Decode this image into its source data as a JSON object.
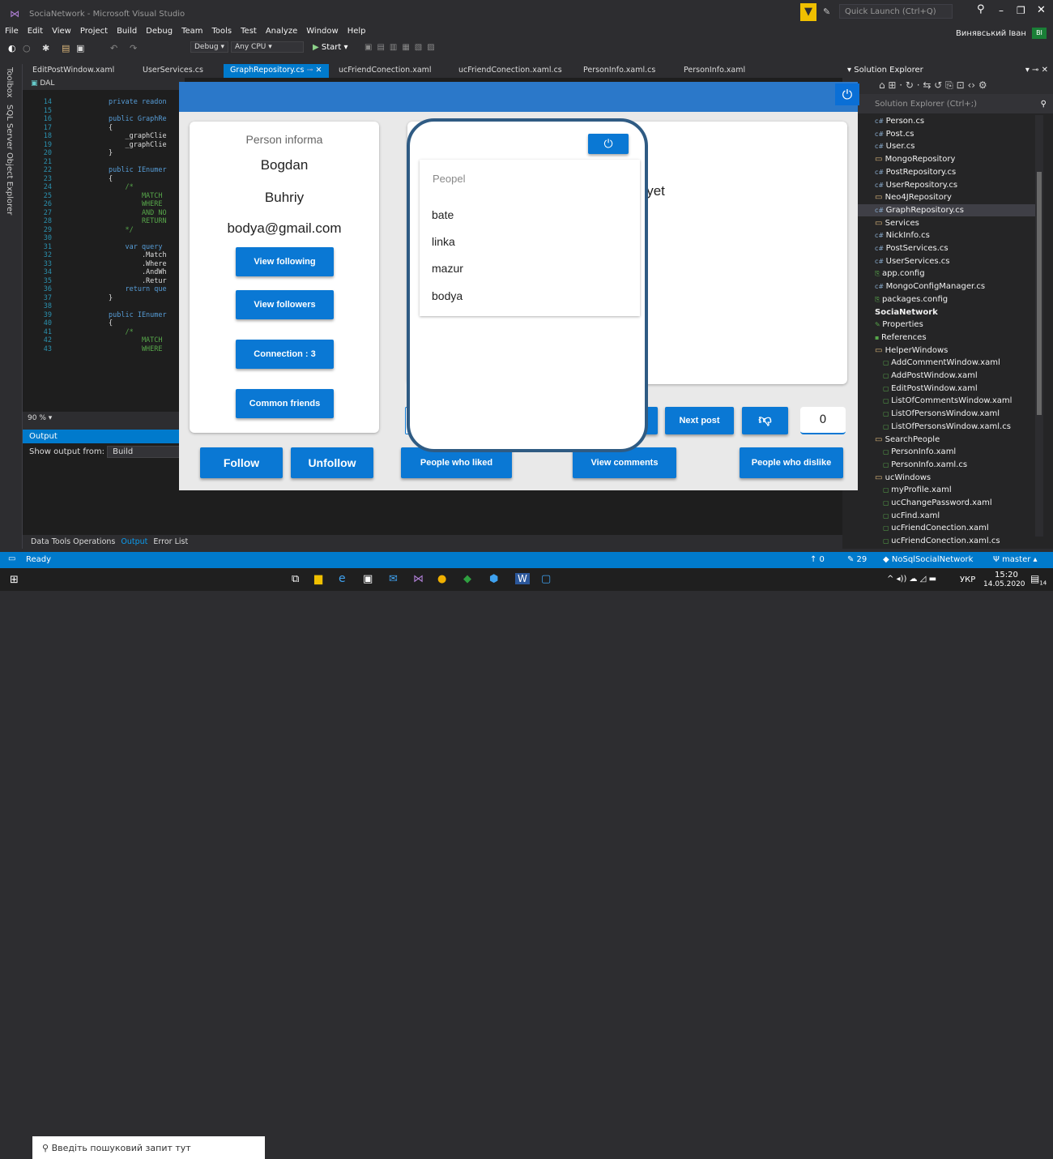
{
  "ide": {
    "window_title": "SociaNetwork - Microsoft Visual Studio",
    "quick_launch": "Quick Launch (Ctrl+Q)",
    "user": "Винявський Іван",
    "user_initials": "ВІ",
    "menu": [
      "File",
      "Edit",
      "View",
      "Project",
      "Build",
      "Debug",
      "Team",
      "Tools",
      "Test",
      "Analyze",
      "Window",
      "Help"
    ],
    "toolbar": {
      "config": "Debug",
      "platform": "Any CPU",
      "start": "Start"
    },
    "tabs": [
      "EditPostWindow.xaml",
      "UserServices.cs",
      "GraphRepository.cs",
      "ucFriendConection.xaml",
      "ucFriendConection.xaml.cs",
      "PersonInfo.xaml.cs",
      "PersonInfo.xaml"
    ],
    "left_rail": [
      "Toolbox",
      "SQL Server Object Explorer"
    ],
    "editor_project": "DAL",
    "zoom": "90 %",
    "output": {
      "title": "Output",
      "show_from_label": "Show output from:",
      "show_from_value": "Build"
    },
    "bottom_tabs": [
      "Data Tools Operations",
      "Output",
      "Error List"
    ],
    "code_lines": [
      {
        "n": "14",
        "t": "private readon"
      },
      {
        "n": "15",
        "t": ""
      },
      {
        "n": "16",
        "t": "public GraphRe"
      },
      {
        "n": "17",
        "t": "{"
      },
      {
        "n": "18",
        "t": "    _graphClie"
      },
      {
        "n": "19",
        "t": "    _graphClie"
      },
      {
        "n": "20",
        "t": "}"
      },
      {
        "n": "21",
        "t": ""
      },
      {
        "n": "22",
        "t": "public IEnumer"
      },
      {
        "n": "23",
        "t": "{"
      },
      {
        "n": "24",
        "t": "    /*"
      },
      {
        "n": "25",
        "t": "        MATCH"
      },
      {
        "n": "26",
        "t": "        WHERE"
      },
      {
        "n": "27",
        "t": "        AND NO"
      },
      {
        "n": "28",
        "t": "        RETURN"
      },
      {
        "n": "29",
        "t": "    */"
      },
      {
        "n": "30",
        "t": ""
      },
      {
        "n": "31",
        "t": "    var query"
      },
      {
        "n": "32",
        "t": "        .Match"
      },
      {
        "n": "33",
        "t": "        .Where"
      },
      {
        "n": "34",
        "t": "        .AndWh"
      },
      {
        "n": "35",
        "t": "        .Retur"
      },
      {
        "n": "36",
        "t": "    return que"
      },
      {
        "n": "37",
        "t": "}"
      },
      {
        "n": "38",
        "t": ""
      },
      {
        "n": "39",
        "t": "public IEnumer"
      },
      {
        "n": "40",
        "t": "{"
      },
      {
        "n": "41",
        "t": "    /*"
      },
      {
        "n": "42",
        "t": "        MATCH"
      },
      {
        "n": "43",
        "t": "        WHERE"
      }
    ],
    "solution_explorer": {
      "title": "Solution Explorer",
      "search": "Solution Explorer (Ctrl+;)",
      "items": [
        {
          "label": "Person.cs",
          "kind": "cs"
        },
        {
          "label": "Post.cs",
          "kind": "cs"
        },
        {
          "label": "User.cs",
          "kind": "cs"
        },
        {
          "label": "MongoRepository",
          "kind": "folder"
        },
        {
          "label": "PostRepository.cs",
          "kind": "cs"
        },
        {
          "label": "UserRepository.cs",
          "kind": "cs"
        },
        {
          "label": "Neo4JRepository",
          "kind": "folder"
        },
        {
          "label": "GraphRepository.cs",
          "kind": "cs",
          "selected": true
        },
        {
          "label": "Services",
          "kind": "folder"
        },
        {
          "label": "NickInfo.cs",
          "kind": "cs"
        },
        {
          "label": "PostServices.cs",
          "kind": "cs"
        },
        {
          "label": "UserServices.cs",
          "kind": "cs"
        },
        {
          "label": "app.config",
          "kind": "cfg"
        },
        {
          "label": "MongoConfigManager.cs",
          "kind": "cs"
        },
        {
          "label": "packages.config",
          "kind": "cfg"
        },
        {
          "label": "SociaNetwork",
          "kind": "project"
        },
        {
          "label": "Properties",
          "kind": "prop"
        },
        {
          "label": "References",
          "kind": "ref"
        },
        {
          "label": "HelperWindows",
          "kind": "folder"
        },
        {
          "label": "AddCommentWindow.xaml",
          "kind": "xaml"
        },
        {
          "label": "AddPostWindow.xaml",
          "kind": "xaml"
        },
        {
          "label": "EditPostWindow.xaml",
          "kind": "xaml"
        },
        {
          "label": "ListOfCommentsWindow.xaml",
          "kind": "xaml"
        },
        {
          "label": "ListOfPersonsWindow.xaml",
          "kind": "xaml"
        },
        {
          "label": "ListOfPersonsWindow.xaml.cs",
          "kind": "xaml"
        },
        {
          "label": "SearchPeople",
          "kind": "folder"
        },
        {
          "label": "PersonInfo.xaml",
          "kind": "xaml"
        },
        {
          "label": "PersonInfo.xaml.cs",
          "kind": "xaml"
        },
        {
          "label": "ucWindows",
          "kind": "folder"
        },
        {
          "label": "myProfile.xaml",
          "kind": "xaml"
        },
        {
          "label": "ucChangePassword.xaml",
          "kind": "xaml"
        },
        {
          "label": "ucFind.xaml",
          "kind": "xaml"
        },
        {
          "label": "ucFriendConection.xaml",
          "kind": "xaml"
        },
        {
          "label": "ucFriendConection.xaml.cs",
          "kind": "xaml"
        }
      ]
    },
    "status": {
      "ready": "Ready",
      "up": "↑ 0",
      "edits": "✎ 29",
      "repo": "NoSqlSocialNetwork",
      "branch": "master"
    },
    "taskbar": {
      "search": "Введіть пошуковий запит тут",
      "lang": "УКР",
      "time": "15:20",
      "date": "14.05.2020",
      "notif": "14"
    }
  },
  "app": {
    "person": {
      "header": "Person informa",
      "first_name": "Bogdan",
      "last_name": "Buhriy",
      "email": "bodya@gmail.com"
    },
    "buttons": {
      "view_following": "View following",
      "view_followers": "View followers",
      "connection": "Connection : 3",
      "common_friends": "Common friends",
      "follow": "Follow",
      "unfollow": "Unfollow",
      "people_who_liked": "People who liked",
      "view_comments": "View comments",
      "people_who_dislike": "People who dislike",
      "next_post": "Next post"
    },
    "post_text": "s yet",
    "dislike_count": "0",
    "popup": {
      "list_header": "Peopel",
      "people": [
        "bate",
        "linka",
        "mazur",
        "bodya"
      ]
    }
  }
}
